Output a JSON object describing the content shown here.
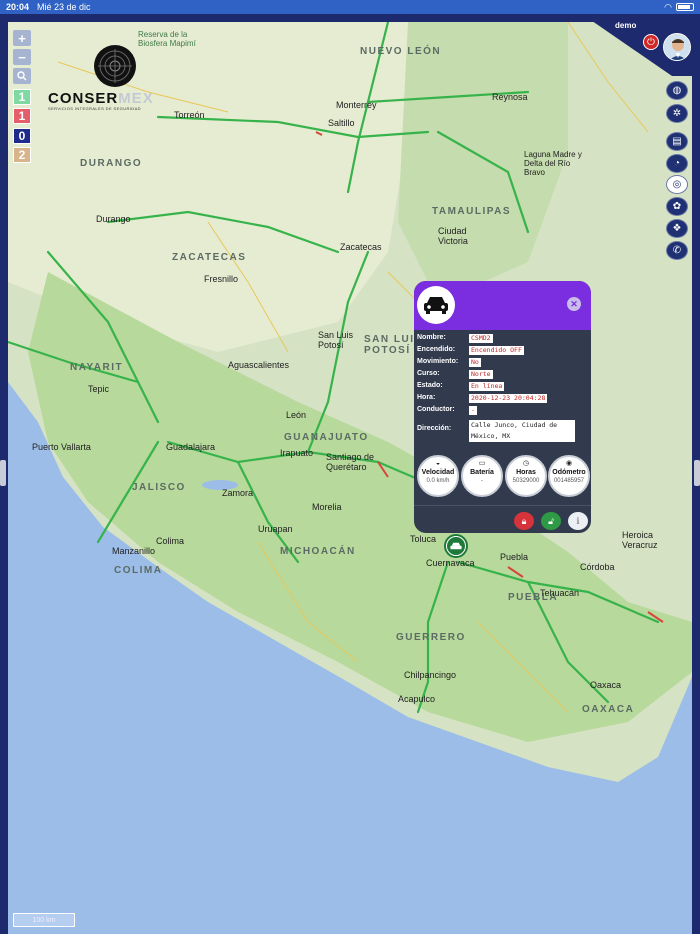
{
  "status_bar": {
    "time": "20:04",
    "date": "Mié 23 de dic"
  },
  "user": {
    "name": "demo"
  },
  "logo": {
    "text_dark": "CONSER",
    "text_light": "MEX",
    "subtitle": "SERVICIOS INTEGRALES DE SEGURIDAD"
  },
  "map_controls": {
    "zoom_in": "+",
    "zoom_out": "−"
  },
  "counters": [
    {
      "value": "1",
      "color": "#7fd9a0"
    },
    {
      "value": "1",
      "color": "#e45f6a"
    },
    {
      "value": "0",
      "color": "#1d2b8c"
    },
    {
      "value": "2",
      "color": "#d7b48a"
    }
  ],
  "toolbar_icons": [
    "globe-icon",
    "gear-icon",
    "document-icon",
    "chat-icon",
    "target-icon",
    "paw-icon",
    "layers-icon",
    "whatsapp-icon"
  ],
  "popup": {
    "fields": [
      {
        "label": "Nombre:",
        "value": "CSMD2"
      },
      {
        "label": "Encendido:",
        "value": "Encendido OFF"
      },
      {
        "label": "Movimiento:",
        "value": "No"
      },
      {
        "label": "Curso:",
        "value": "Norte"
      },
      {
        "label": "Estado:",
        "value": "En línea"
      },
      {
        "label": "Hora:",
        "value": "2020-12-23 20:04:28"
      },
      {
        "label": "Conductor:",
        "value": "-"
      },
      {
        "label": "Dirección:",
        "value": "Calle Junco, Ciudad de México, MX"
      }
    ],
    "metrics": [
      {
        "title": "Velocidad",
        "value": "0.0 km/h"
      },
      {
        "title": "Batería",
        "value": "-"
      },
      {
        "title": "Horas",
        "value": "50329000"
      },
      {
        "title": "Odómetro",
        "value": "001485957"
      }
    ]
  },
  "map_labels": {
    "states": [
      "NUEVO LEÓN",
      "DURANGO",
      "TAMAULIPAS",
      "ZACATECAS",
      "NAYARIT",
      "SAN LUIS POTOSÍ",
      "GUANAJUATO",
      "JALISCO",
      "MICHOACÁN",
      "COLIMA",
      "PUEBLA",
      "GUERRERO",
      "OAXACA"
    ],
    "cities": [
      "Monterrey",
      "Reynosa",
      "Torreón",
      "Saltillo",
      "Durango",
      "Ciudad Victoria",
      "Zacatecas",
      "Fresnillo",
      "San Luis Potosí",
      "Aguascalientes",
      "Tepic",
      "León",
      "Puerto Vallarta",
      "Guadalajara",
      "Irapuato",
      "Santiago de Querétaro",
      "Zamora",
      "Morelia",
      "Colima",
      "Manzanillo",
      "Uruapan",
      "Toluca",
      "Cuernavaca",
      "Puebla",
      "Tehuacán",
      "Córdoba",
      "Chilpancingo",
      "Acapulco",
      "Oaxaca",
      "Heroica Veracruz",
      "Laguna Madre y Delta del Río Bravo",
      "Reserva de la Biosfera Mapimí"
    ]
  },
  "scale_bar": "100 km"
}
